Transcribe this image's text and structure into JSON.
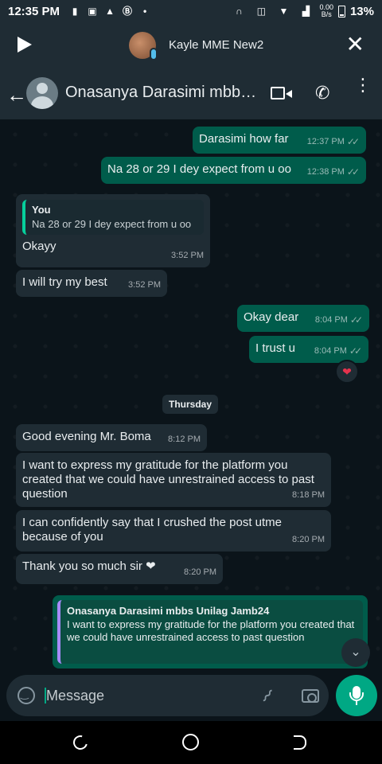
{
  "status_bar": {
    "time": "12:35 PM",
    "net_speed_top": "0.00",
    "net_speed_bottom": "B/s",
    "battery": "13%"
  },
  "audio_player": {
    "name": "Kayle MME New2",
    "icons": [
      "play-icon",
      "mic-icon",
      "close-icon"
    ]
  },
  "header": {
    "contact_name": "Onasanya Darasimi mbbs...",
    "icons": [
      "back-arrow-icon",
      "avatar",
      "video-call-icon",
      "phone-icon",
      "more-icon"
    ]
  },
  "messages": [
    {
      "dir": "out",
      "text": "Darasimi how far",
      "time": "12:37 PM",
      "status": "read"
    },
    {
      "dir": "out",
      "text": "Na 28 or 29 I dey expect from u oo",
      "time": "12:38 PM",
      "status": "read"
    },
    {
      "dir": "in",
      "quote_author": "You",
      "quote_text": "Na 28 or 29 I dey expect from u oo",
      "text": "Okayy",
      "time": "3:52 PM"
    },
    {
      "dir": "in",
      "text": "I will try my best",
      "time": "3:52 PM"
    },
    {
      "dir": "out",
      "text": "Okay dear",
      "time": "8:04 PM",
      "status": "read"
    },
    {
      "dir": "out",
      "text": "I trust u",
      "time": "8:04 PM",
      "status": "read",
      "reaction": "❤"
    },
    {
      "dir": "in",
      "text": "Good evening Mr. Boma",
      "time": "8:12 PM"
    },
    {
      "dir": "in",
      "text": "I want to express my gratitude for the platform you created that we could have unrestrained access to past question",
      "time": "8:18 PM"
    },
    {
      "dir": "in",
      "text": "I can confidently say that I crushed the post utme because of you",
      "time": "8:20 PM"
    },
    {
      "dir": "in",
      "text": "Thank you so much sir ❤",
      "time": "8:20 PM"
    }
  ],
  "day_separator": "Thursday",
  "reply_preview": {
    "author": "Onasanya Darasimi mbbs Unilag Jamb24",
    "text": "I want to express my gratitude for the platform you created that we could have unrestrained access to past question"
  },
  "composer": {
    "placeholder": "Message"
  },
  "colors": {
    "outgoing_bubble": "#005c4b",
    "incoming_bubble": "#1f2c34",
    "accent": "#00a884",
    "background": "#0b141a"
  }
}
